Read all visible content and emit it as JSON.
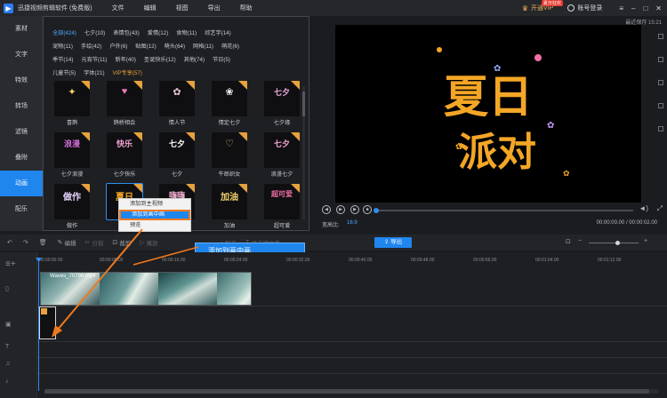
{
  "app": {
    "title": "迅捷视频剪辑软件 (免费版)"
  },
  "menu": [
    "文件",
    "编辑",
    "视图",
    "导出",
    "帮助"
  ],
  "titlebar": {
    "vip_label": "开通VIP",
    "vip_badge": "夏日狂欢",
    "login_label": "账号登录"
  },
  "sidebar": {
    "items": [
      {
        "label": "素材",
        "active": false
      },
      {
        "label": "文字",
        "active": false
      },
      {
        "label": "特效",
        "active": false
      },
      {
        "label": "转场",
        "active": false
      },
      {
        "label": "滤镜",
        "active": false
      },
      {
        "label": "叠附",
        "active": false
      },
      {
        "label": "动画",
        "active": true
      },
      {
        "label": "配乐",
        "active": false
      }
    ]
  },
  "categories": {
    "row1": [
      "全部(424)",
      "七夕(10)",
      "表情包(43)",
      "爱情(12)",
      "食物(11)",
      "综艺字(14)"
    ],
    "row2": [
      "宠物(11)",
      "手绘(42)",
      "户外(6)",
      "贴图(12)",
      "萌头(64)",
      "网格(11)",
      "萌花(6)"
    ],
    "row3": [
      "季节(14)",
      "元宵节(11)",
      "新年(40)",
      "圣诞快乐(12)",
      "其他(74)",
      "节日(5)"
    ],
    "row4": [
      "儿童节(5)",
      "字体(21)",
      "VIP专享(57)"
    ]
  },
  "tiles": {
    "row1": [
      {
        "label": "喜鹊",
        "art": "✦"
      },
      {
        "label": "鹊桥相会",
        "art": "♥"
      },
      {
        "label": "情人节",
        "art": "✿"
      },
      {
        "label": "情定七夕",
        "art": "❀"
      },
      {
        "label": "七夕缘",
        "art": "七夕"
      }
    ],
    "row2": [
      {
        "label": "七夕浪漫",
        "art": "浪漫"
      },
      {
        "label": "七夕快乐",
        "art": "快乐"
      },
      {
        "label": "七夕",
        "art": "七夕"
      },
      {
        "label": "牛郎织女",
        "art": "♡"
      },
      {
        "label": "浪漫七夕",
        "art": "七夕"
      }
    ],
    "row3": [
      {
        "label": "做作",
        "art": "做作"
      },
      {
        "label": "夏日",
        "art": "夏日"
      },
      {
        "label": "嗨",
        "art": "嗨嗨"
      },
      {
        "label": "加油",
        "art": "加油"
      },
      {
        "label": "超可爱",
        "art": "超可爱"
      }
    ]
  },
  "context_menu": [
    "添加到主视频",
    "添加到画中画",
    "预览"
  ],
  "tooltip": "添加到画中画",
  "preview": {
    "saved_text": "最近保存 15:21",
    "sticker_line1": "夏日",
    "sticker_line2": "派对",
    "ratio_label": "宽高比:",
    "ratio_value": "16:9",
    "timecode": "00:00:00.00 / 00:00:02.00",
    "progress": 0
  },
  "toolbar": {
    "items": [
      "编辑",
      "分割",
      "裁剪",
      "播放",
      "配音",
      "画中画",
      "边框",
      "语音转文字"
    ],
    "export_label": "导出"
  },
  "timeline": {
    "ticks": [
      "00:00:00.00",
      "00:00:08.00",
      "00:00:16.00",
      "00:00:24.00",
      "00:00:32.00",
      "00:00:40.00",
      "00:00:48.00",
      "00:00:56.00",
      "00:01:04.00",
      "00:01:12.00"
    ],
    "clip_name": "Waves_70796.mp4"
  },
  "colors": {
    "accent": "#1f86ee",
    "vip": "#e6a23c",
    "sticker_yellow": "#f4a626"
  }
}
